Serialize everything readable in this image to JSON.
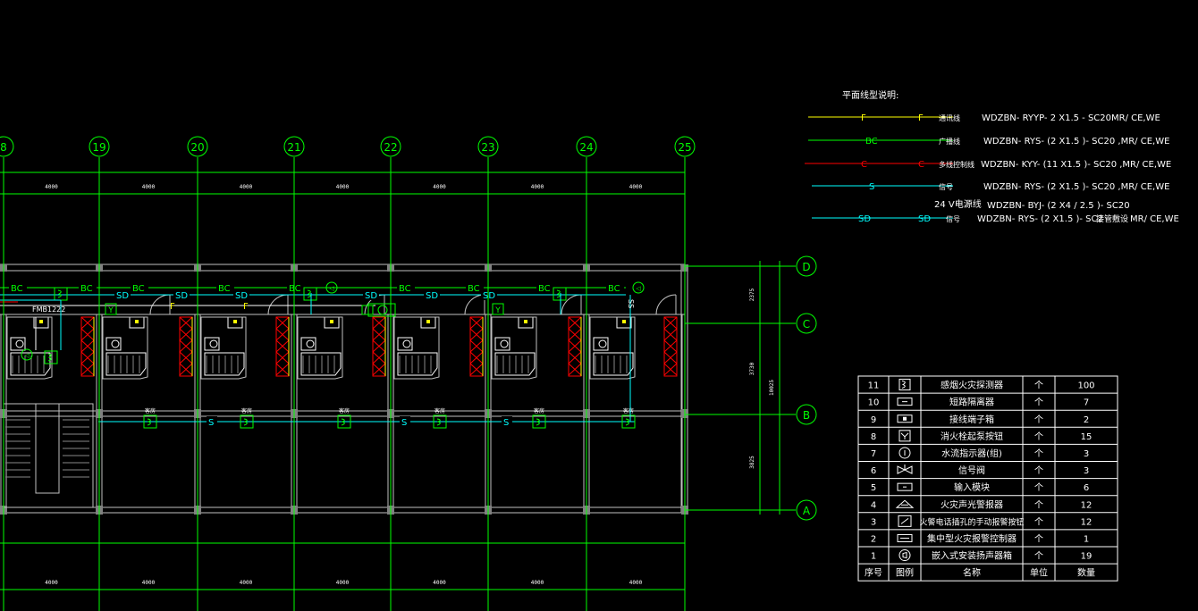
{
  "legend": {
    "title": "平面线型说明:",
    "rows": [
      {
        "symbol": "F",
        "color": "#ffff00",
        "name": "通讯线",
        "spec": "WDZBN- RYYP- 2 X1.5 - SC20MR/ CE,WE"
      },
      {
        "symbol": "BC",
        "color": "#00ff00",
        "name": "广播线",
        "spec": "WDZBN- RYS- (2 X1.5 )- SC20 ,MR/ CE,WE"
      },
      {
        "symbol": "C",
        "color": "#ff0000",
        "name": "多线控制线",
        "spec": "WDZBN- KYY- (11 X1.5 )- SC20 ,MR/ CE,WE"
      },
      {
        "symbol": "S",
        "color": "#00ffff",
        "name": "信号",
        "spec": "WDZBN- RYS- (2 X1.5 )- SC20 ,MR/ CE,WE"
      },
      {
        "symbol": "",
        "color": "#ffffff",
        "name": "24 V电源线",
        "spec": "WDZBN- BYJ- (2 X4 / 2.5 )- SC20"
      },
      {
        "symbol": "SD",
        "color": "#00ffff",
        "name": "信号",
        "spec": "WDZBN- RYS- (2 X1.5 )- SC2\u0000MR/ CE,WE"
      }
    ],
    "overlap_note": "接管敷设"
  },
  "axes": {
    "columns": [
      "8",
      "19",
      "20",
      "21",
      "22",
      "23",
      "24",
      "25"
    ],
    "rows": [
      "D",
      "C",
      "B",
      "A"
    ],
    "top_dims": [
      "4000",
      "4000",
      "4000",
      "4000",
      "4000",
      "4000",
      "4000"
    ],
    "bottom_dims": [
      "4000",
      "4000",
      "4000",
      "4000",
      "4000",
      "4000",
      "4000"
    ],
    "right_dims": [
      "2375",
      "3730",
      "3825"
    ],
    "right_total": "10025"
  },
  "plan_labels": {
    "fmb": "FMB1222",
    "room_tag": "客房",
    "wire_bc": "BC",
    "wire_sd": "SD",
    "wire_s": "S",
    "wire_f": "F",
    "pipe_tag": "SS"
  },
  "table": {
    "headers": [
      "序号",
      "图例",
      "名称",
      "单位",
      "数量"
    ],
    "rows": [
      {
        "no": "11",
        "icon": "smoke-detector",
        "name": "感烟火灾探测器",
        "unit": "个",
        "qty": "100"
      },
      {
        "no": "10",
        "icon": "short-circuit-isolator",
        "name": "短路隔离器",
        "unit": "个",
        "qty": "7"
      },
      {
        "no": "9",
        "icon": "terminal-box",
        "name": "接线端子箱",
        "unit": "个",
        "qty": "2"
      },
      {
        "no": "8",
        "icon": "hydrant-button",
        "name": "消火栓起泵按钮",
        "unit": "个",
        "qty": "15"
      },
      {
        "no": "7",
        "icon": "water-flow-indicator",
        "name": "水流指示器(组)",
        "unit": "个",
        "qty": "3"
      },
      {
        "no": "6",
        "icon": "signal-valve",
        "name": "信号阀",
        "unit": "个",
        "qty": "3"
      },
      {
        "no": "5",
        "icon": "input-module",
        "name": "输入模块",
        "unit": "个",
        "qty": "6"
      },
      {
        "no": "4",
        "icon": "sound-light-alarm",
        "name": "火灾声光警报器",
        "unit": "个",
        "qty": "12"
      },
      {
        "no": "3",
        "icon": "manual-alarm-button",
        "name": "火警电话插孔的手动报警按钮",
        "unit": "个",
        "qty": "12"
      },
      {
        "no": "2",
        "icon": "fire-alarm-controller",
        "name": "集中型火灾报警控制器",
        "unit": "个",
        "qty": "1"
      },
      {
        "no": "1",
        "icon": "ceiling-speaker",
        "name": "嵌入式安装扬声器箱",
        "unit": "个",
        "qty": "19"
      }
    ]
  },
  "colors": {
    "background": "#000000",
    "axis": "#00ff00",
    "wall": "#c0c0c0",
    "signal": "#00ffff",
    "control": "#ff0000",
    "comm": "#ffff00",
    "text": "#ffffff"
  }
}
